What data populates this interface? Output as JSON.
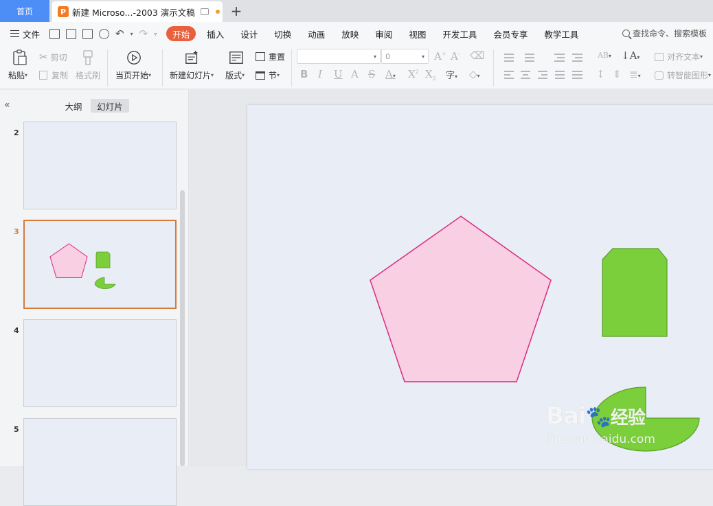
{
  "tabs": {
    "home": "首页",
    "doc_title": "新建 Microso...-2003 演示文稿",
    "doc_icon": "P"
  },
  "menu": {
    "file": "文件",
    "items": [
      "开始",
      "插入",
      "设计",
      "切换",
      "动画",
      "放映",
      "审阅",
      "视图",
      "开发工具",
      "会员专享",
      "教学工具"
    ],
    "search": "查找命令、搜索模板"
  },
  "ribbon": {
    "paste": "粘贴",
    "cut": "剪切",
    "copy": "复制",
    "format_painter": "格式刷",
    "play_from_current": "当页开始",
    "new_slide": "新建幻灯片",
    "layout": "版式",
    "reset": "重置",
    "section": "节",
    "font_name": "",
    "font_size": "0",
    "align_text": "对齐文本",
    "smart_graphic": "转智能图形"
  },
  "panel": {
    "outline_tab": "大纲",
    "slides_tab": "幻灯片",
    "slide_numbers": [
      "2",
      "3",
      "4",
      "5"
    ]
  },
  "watermark": {
    "brand": "Bai",
    "brand_cn": "经验",
    "url": "jingyan.baidu.com"
  },
  "colors": {
    "pentagon_fill": "#f9cfe4",
    "pentagon_stroke": "#d92c7f",
    "green_fill": "#7acf3a",
    "green_stroke": "#5a9e2a",
    "accent_tab": "#e8603c",
    "home_tab": "#4c8df6"
  }
}
